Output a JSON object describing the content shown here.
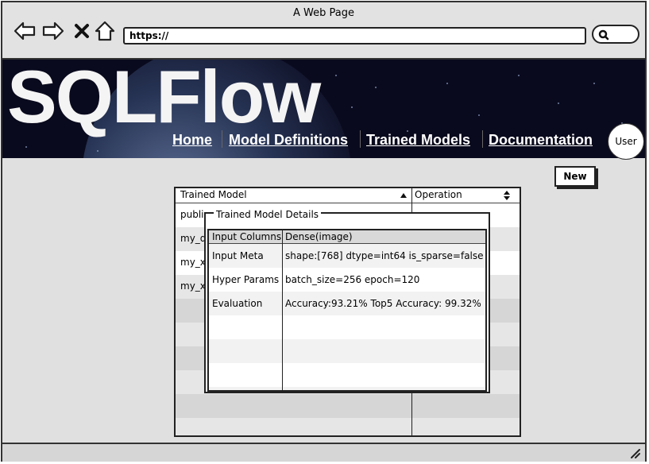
{
  "browser": {
    "title": "A Web Page",
    "url": "https://"
  },
  "header": {
    "logo": "SQLFlow",
    "nav": [
      "Home",
      "Model Definitions",
      "Trained Models",
      "Documentation"
    ],
    "user_label": "User"
  },
  "toolbar": {
    "new_label": "New"
  },
  "table": {
    "columns": [
      "Trained Model",
      "Operation"
    ],
    "rows": [
      "public",
      "my_d",
      "my_x",
      "my_x"
    ]
  },
  "dialog": {
    "title": "Trained Model Details",
    "header": {
      "key": "Input Columns",
      "value": "Dense(image)"
    },
    "rows": [
      {
        "key": "Input Meta",
        "value": "shape:[768] dtype=int64 is_sparse=false"
      },
      {
        "key": "Hyper Params",
        "value": "batch_size=256 epoch=120"
      },
      {
        "key": "Evaluation",
        "value": "Accuracy:93.21% Top5 Accuracy: 99.32%"
      }
    ]
  }
}
